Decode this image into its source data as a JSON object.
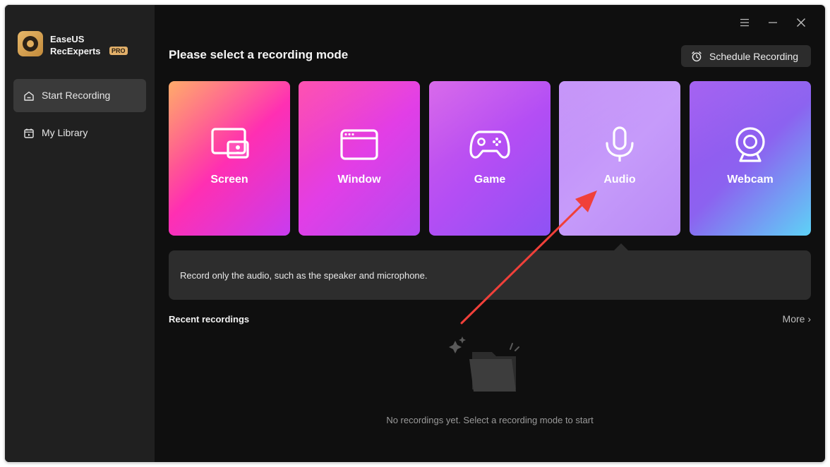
{
  "app": {
    "brand_line1": "EaseUS",
    "brand_line2": "RecExperts",
    "badge": "PRO"
  },
  "sidebar": {
    "items": [
      {
        "label": "Start Recording",
        "icon": "home-icon",
        "active": true
      },
      {
        "label": "My Library",
        "icon": "library-icon",
        "active": false
      }
    ]
  },
  "header": {
    "title": "Please select a recording mode",
    "schedule_label": "Schedule Recording",
    "controls": [
      "menu-icon",
      "minimize-icon",
      "close-icon"
    ]
  },
  "modes": [
    {
      "label": "Screen",
      "icon": "screen-icon",
      "colors": [
        "#ffa25a",
        "#ff2fb2",
        "#c83cf0"
      ]
    },
    {
      "label": "Window",
      "icon": "window-icon",
      "colors": [
        "#ff3fa8",
        "#e23ee6",
        "#b34af2"
      ]
    },
    {
      "label": "Game",
      "icon": "gamepad-icon",
      "colors": [
        "#d45ae8",
        "#b44ef4",
        "#8e52f4"
      ]
    },
    {
      "label": "Audio",
      "icon": "microphone-icon",
      "colors": [
        "#c08af8",
        "#c69bfa",
        "#b88af6"
      ],
      "selected": true
    },
    {
      "label": "Webcam",
      "icon": "webcam-icon",
      "colors": [
        "#9c52f0",
        "#8c62f0",
        "#5ed2f6"
      ]
    }
  ],
  "description": "Record only the audio, such as the speaker and microphone.",
  "recent": {
    "title": "Recent recordings",
    "more_label": "More",
    "empty_text": "No recordings yet. Select a recording mode to start"
  },
  "colors": {
    "sidebar_bg": "#202020",
    "main_bg": "#0f0f0f",
    "accent_arrow": "#f0403a"
  }
}
